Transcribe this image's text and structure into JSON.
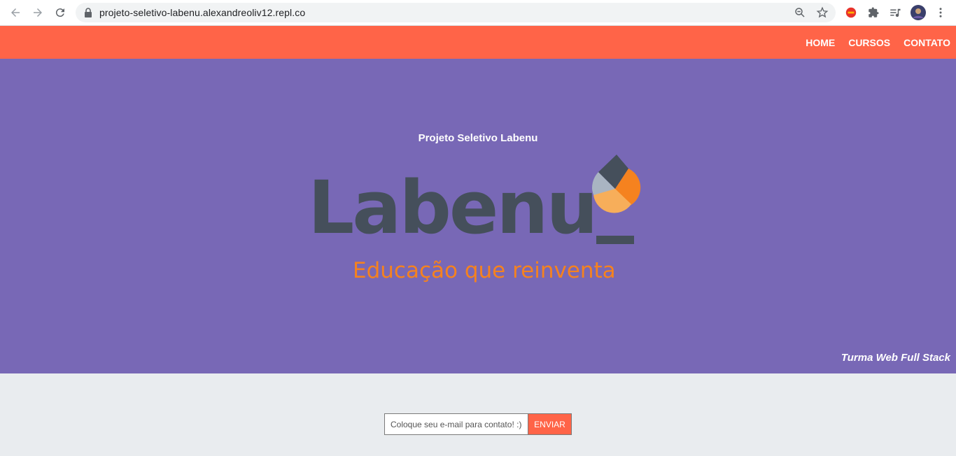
{
  "browser": {
    "url": "projeto-seletivo-labenu.alexandreoliv12.repl.co"
  },
  "nav": {
    "items": [
      {
        "label": "HOME"
      },
      {
        "label": "CURSOS"
      },
      {
        "label": "CONTATO"
      }
    ]
  },
  "hero": {
    "title": "Projeto Seletivo Labenu",
    "logo_word": "Labenu",
    "logo_tagline": "Educação que reinventa",
    "turma": "Turma Web Full Stack"
  },
  "contact": {
    "placeholder": "Coloque seu e-mail para contato! :)",
    "submit_label": "ENVIAR"
  },
  "colors": {
    "header": "#ff6448",
    "hero": "#7868b6",
    "logo_dark": "#454f5b",
    "logo_orange": "#f5821f"
  }
}
